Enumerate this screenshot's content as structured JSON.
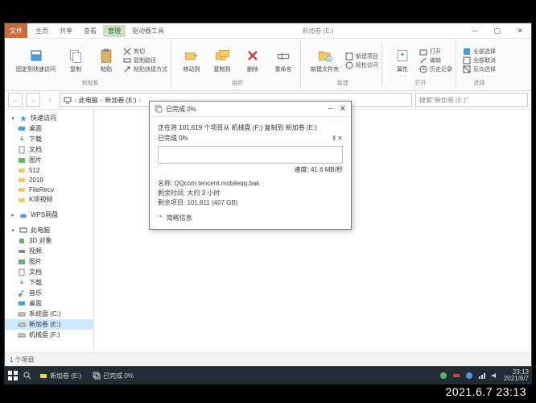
{
  "window": {
    "activeTab": "文件",
    "tabs": [
      "主页",
      "共享",
      "查看"
    ],
    "contextTabGroup": "管理",
    "contextTab": "驱动器工具",
    "title": "新加卷 (E:)"
  },
  "ribbon": {
    "group_clipboard": {
      "label": "剪贴板",
      "pin": "固定到快速访问",
      "copy": "复制",
      "paste": "粘贴",
      "cut": "剪切",
      "copy_path": "复制路径",
      "paste_shortcut": "粘贴快捷方式"
    },
    "group_organize": {
      "label": "组织",
      "move_to": "移动到",
      "copy_to": "复制到",
      "delete": "删除",
      "rename": "重命名"
    },
    "group_new": {
      "label": "新建",
      "new_folder": "新建文件夹",
      "new_item": "新建项目",
      "easy_access": "轻松访问"
    },
    "group_open": {
      "label": "打开",
      "properties": "属性",
      "open": "打开",
      "edit": "编辑",
      "history": "历史记录"
    },
    "group_select": {
      "label": "选择",
      "select_all": "全部选择",
      "select_none": "全部取消",
      "invert": "反向选择"
    }
  },
  "address": {
    "crumbs": [
      "此电脑",
      "新加卷 (E:)"
    ],
    "search_placeholder": "搜索\"新加卷 (E:)\""
  },
  "sidebar": {
    "quick_access": "快速访问",
    "items_qa": [
      "桌面",
      "下载",
      "文档",
      "图片",
      "512",
      "2019",
      "FileRecv",
      "K项视频"
    ],
    "wps": "WPS网盘",
    "this_pc": "此电脑",
    "items_pc": [
      "3D 对象",
      "视频",
      "图片",
      "文档",
      "下载",
      "音乐",
      "桌面",
      "系统盘 (C:)",
      "新加卷 (E:)",
      "机械盘 (F:)"
    ],
    "selected": "新加卷 (E:)"
  },
  "dialog": {
    "title": "已完成 0%",
    "summary": "正在将 101,619 个项目从 机械盘 (F:) 复制到 新加卷 (E:)",
    "progress_label": "已完成 0%",
    "speed": "速度: 41.6 MB/秒",
    "name_label": "名称:",
    "name_value": "QQcom.tencent.mobileqq.bak",
    "time_label": "剩余时间:",
    "time_value": "大约 3 小时",
    "remaining_label": "剩余项目:",
    "remaining_value": "101,611 (407 GB)",
    "more": "简略信息"
  },
  "statusbar": {
    "text": "1 个项目"
  },
  "taskbar": {
    "items": [
      "新加卷 (E:)",
      "已完成 0%"
    ],
    "time": "23:13",
    "date": "2021/6/7"
  },
  "watermark": "2021.6.7 23:13"
}
